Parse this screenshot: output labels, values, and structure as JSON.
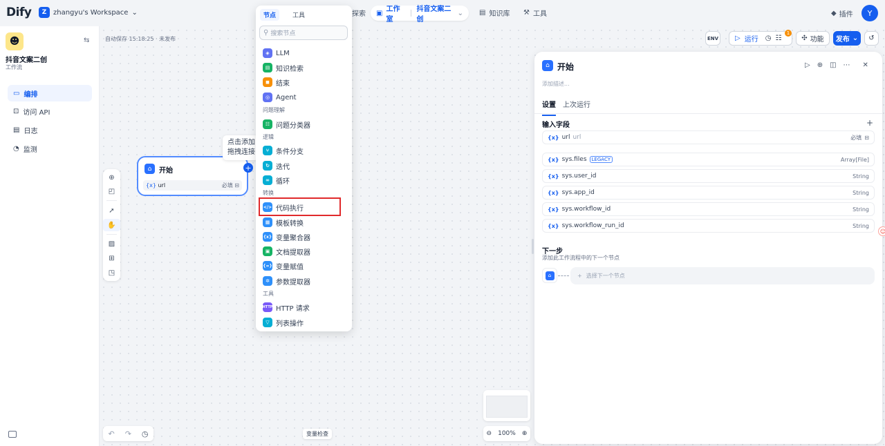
{
  "header": {
    "logo": "Dify",
    "workspace_badge": "Z",
    "workspace": "zhangyu's Workspace",
    "nav_explore": "探索",
    "nav_studio": "工作室",
    "nav_app": "抖音文案二创",
    "nav_knowledge": "知识库",
    "nav_tools": "工具",
    "plugins": "插件",
    "avatar": "Y"
  },
  "sidebar": {
    "app_name": "抖音文案二创",
    "app_type": "工作流",
    "items": [
      {
        "label": "编排",
        "icon": "layout-icon",
        "active": true
      },
      {
        "label": "访问 API",
        "icon": "terminal-icon",
        "active": false
      },
      {
        "label": "日志",
        "icon": "log-icon",
        "active": false
      },
      {
        "label": "监测",
        "icon": "monitor-icon",
        "active": false
      }
    ]
  },
  "canvas": {
    "autosave": "自动保存 15:18:25 · 未发布",
    "tooltip_line1": "点击添加",
    "tooltip_line2": "拖拽连接",
    "start_node": {
      "title": "开始",
      "var": "url",
      "required": "必填"
    },
    "zoom": "100%",
    "var_check": "变量检查"
  },
  "node_picker": {
    "tab_nodes": "节点",
    "tab_tools": "工具",
    "search_placeholder": "搜索节点",
    "highlighted": "代码执行",
    "items_basic": [
      {
        "label": "LLM",
        "color": "#6172f3",
        "glyph": "◈"
      },
      {
        "label": "知识检索",
        "color": "#16b364",
        "glyph": "▤"
      },
      {
        "label": "结束",
        "color": "#f79009",
        "glyph": "◼"
      },
      {
        "label": "Agent",
        "color": "#6172f3",
        "glyph": "◎"
      }
    ],
    "cat_understanding": "问题理解",
    "item_classifier": {
      "label": "问题分类器",
      "color": "#16b364",
      "glyph": "☷"
    },
    "cat_logic": "逻辑",
    "items_logic": [
      {
        "label": "条件分支",
        "color": "#06aed4",
        "glyph": "⑂"
      },
      {
        "label": "迭代",
        "color": "#06aed4",
        "glyph": "↻"
      },
      {
        "label": "循环",
        "color": "#06aed4",
        "glyph": "∞"
      }
    ],
    "cat_transform": "转换",
    "items_transform": [
      {
        "label": "代码执行",
        "color": "#2e90fa",
        "glyph": "</>"
      },
      {
        "label": "模板转换",
        "color": "#2e90fa",
        "glyph": "▦"
      },
      {
        "label": "变量聚合器",
        "color": "#2e90fa",
        "glyph": "{x}"
      },
      {
        "label": "文档提取器",
        "color": "#16b364",
        "glyph": "▣"
      },
      {
        "label": "变量赋值",
        "color": "#2e90fa",
        "glyph": "{=}"
      },
      {
        "label": "参数提取器",
        "color": "#2e90fa",
        "glyph": "✲"
      }
    ],
    "cat_tools": "工具",
    "items_tools": [
      {
        "label": "HTTP 请求",
        "color": "#7a5af8",
        "glyph": "HTTP"
      },
      {
        "label": "列表操作",
        "color": "#06aed4",
        "glyph": "▽"
      }
    ]
  },
  "actions": {
    "env": "ENV",
    "run": "运行",
    "badge": "1",
    "features": "功能",
    "publish": "发布"
  },
  "panel": {
    "title": "开始",
    "desc_placeholder": "添加描述...",
    "tab_settings": "设置",
    "tab_last_run": "上次运行",
    "input_fields": "输入字段",
    "vars": [
      {
        "name": "url",
        "label": "url",
        "tag": "",
        "right": "必填"
      },
      {
        "name": "sys.files",
        "label": "",
        "tag": "LEGACY",
        "right": "Array[File]"
      },
      {
        "name": "sys.user_id",
        "label": "",
        "tag": "",
        "right": "String"
      },
      {
        "name": "sys.app_id",
        "label": "",
        "tag": "",
        "right": "String"
      },
      {
        "name": "sys.workflow_id",
        "label": "",
        "tag": "",
        "right": "String"
      },
      {
        "name": "sys.workflow_run_id",
        "label": "",
        "tag": "",
        "right": "String"
      }
    ],
    "next_step": "下一步",
    "next_step_desc": "添加此工作流程中的下一个节点",
    "select_next": "选择下一个节点"
  },
  "colors": {
    "accent": "#155eef",
    "highlight": "#e0292b"
  }
}
